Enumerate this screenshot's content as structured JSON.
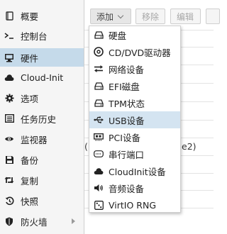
{
  "sidebar": {
    "items": [
      {
        "label": "概要",
        "icon": "book-icon"
      },
      {
        "label": "控制台",
        "icon": "terminal-icon"
      },
      {
        "label": "硬件",
        "icon": "monitor-icon",
        "selected": true
      },
      {
        "label": "Cloud-Init",
        "icon": "cloud-icon"
      },
      {
        "label": "选项",
        "icon": "gear-icon"
      },
      {
        "label": "任务历史",
        "icon": "list-icon"
      },
      {
        "label": "监视器",
        "icon": "eye-icon"
      },
      {
        "label": "备份",
        "icon": "floppy-icon"
      },
      {
        "label": "复制",
        "icon": "retweet-icon"
      },
      {
        "label": "快照",
        "icon": "history-icon"
      },
      {
        "label": "防火墙",
        "icon": "shield-icon",
        "has_submenu": true
      }
    ]
  },
  "toolbar": {
    "add_label": "添加",
    "remove_label": "移除",
    "edit_label": "编辑"
  },
  "background": {
    "peek_text": "e2)",
    "peek_paren": "("
  },
  "add_menu": {
    "items": [
      {
        "label": "硬盘",
        "icon": "hdd-icon"
      },
      {
        "label": "CD/DVD驱动器",
        "icon": "cdrom-icon"
      },
      {
        "label": "网络设备",
        "icon": "network-exchange-icon"
      },
      {
        "label": "EFI磁盘",
        "icon": "hdd-icon"
      },
      {
        "label": "TPM状态",
        "icon": "hdd-icon"
      },
      {
        "label": "USB设备",
        "icon": "usb-icon",
        "highlighted": true
      },
      {
        "label": "PCI设备",
        "icon": "pci-card-icon"
      },
      {
        "label": "串行端口",
        "icon": "serial-port-icon"
      },
      {
        "label": "CloudInit设备",
        "icon": "cloud-icon"
      },
      {
        "label": "音频设备",
        "icon": "volume-icon"
      },
      {
        "label": "VirtIO RNG",
        "icon": "dice-icon"
      }
    ]
  },
  "colors": {
    "selected_bg": "#c5daea",
    "highlight_bg": "#d4e4f1",
    "sidebar_bg": "#f5f5f5"
  }
}
